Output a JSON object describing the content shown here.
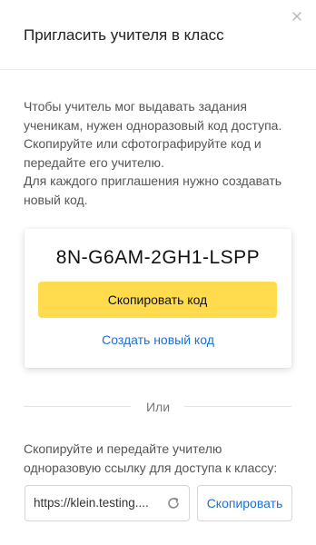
{
  "dialog": {
    "title": "Пригласить учителя в класс",
    "close_icon": "close-icon"
  },
  "description": {
    "lines": [
      "Чтобы учитель мог выдавать задания",
      "ученикам, нужен одноразовый код доступа.",
      "Скопируйте или сфотографируйте код и",
      "передайте его учителю.",
      "Для каждого приглашения нужно создавать",
      "новый код."
    ]
  },
  "code_card": {
    "code": "8N-G6AM-2GH1-LSPP",
    "copy_label": "Скопировать код",
    "new_code_label": "Создать новый код"
  },
  "divider": {
    "label": "Или"
  },
  "link_section": {
    "lines": [
      "Скопируйте и передайте учителю",
      "одноразовую ссылку для доступа к классу:"
    ],
    "link_value": "https://klein.testing....",
    "refresh_icon": "refresh-icon",
    "copy_label": "Скопировать"
  },
  "colors": {
    "accent_yellow": "#ffdb4d",
    "link_blue": "#1e6fd6"
  }
}
